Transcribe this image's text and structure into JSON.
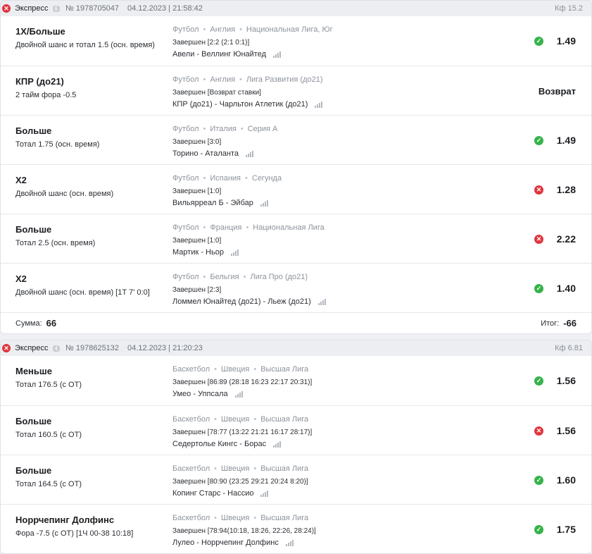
{
  "bets": [
    {
      "type": "Экспресс",
      "count": "6",
      "number": "№ 1978705047",
      "datetime": "04.12.2023 | 21:58:42",
      "kf": "Кф 15.2",
      "sum_label": "Сумма:",
      "sum_value": "66",
      "total_label": "Итог:",
      "total_value": "-66",
      "events": [
        {
          "market": "1X/Больше",
          "outcome": "Двойной шанс и тотал 1.5 (осн. время)",
          "sport": "Футбол",
          "country": "Англия",
          "league": "Национальная Лига, Юг",
          "status": "Завершен [2:2 (2:1 0:1)]",
          "teams": "Авели - Веллинг Юнайтед",
          "result": "win",
          "coef": "1.49"
        },
        {
          "market": "КПР (до21)",
          "outcome": "2 тайм фора -0.5",
          "sport": "Футбол",
          "country": "Англия",
          "league": "Лига Развития (до21)",
          "status": "Завершен [Возврат ставки]",
          "teams": "КПР (до21) - Чарльтон Атлетик (до21)",
          "result": "refund",
          "coef": "Возврат"
        },
        {
          "market": "Больше",
          "outcome": "Тотал 1.75 (осн. время)",
          "sport": "Футбол",
          "country": "Италия",
          "league": "Серия А",
          "status": "Завершен [3:0]",
          "teams": "Торино - Аталанта",
          "result": "win",
          "coef": "1.49"
        },
        {
          "market": "Х2",
          "outcome": "Двойной шанс (осн. время)",
          "sport": "Футбол",
          "country": "Испания",
          "league": "Сегунда",
          "status": "Завершен [1:0]",
          "teams": "Вильярреал Б - Эйбар",
          "result": "loss",
          "coef": "1.28"
        },
        {
          "market": "Больше",
          "outcome": "Тотал 2.5 (осн. время)",
          "sport": "Футбол",
          "country": "Франция",
          "league": "Национальная Лига",
          "status": "Завершен [1:0]",
          "teams": "Мартик - Ньор",
          "result": "loss",
          "coef": "2.22"
        },
        {
          "market": "Х2",
          "outcome": "Двойной шанс (осн. время) [1Т 7' 0:0]",
          "sport": "Футбол",
          "country": "Бельгия",
          "league": "Лига Про (до21)",
          "status": "Завершен [2:3]",
          "teams": "Ломмел Юнайтед (до21) - Льеж (до21)",
          "result": "win",
          "coef": "1.40"
        }
      ]
    },
    {
      "type": "Экспресс",
      "count": "4",
      "number": "№ 1978625132",
      "datetime": "04.12.2023 | 21:20:23",
      "kf": "Кф 6.81",
      "events": [
        {
          "market": "Меньше",
          "outcome": "Тотал 176.5 (с ОТ)",
          "sport": "Баскетбол",
          "country": "Швеция",
          "league": "Высшая Лига",
          "status": "Завершен [86:89 (28:18 16:23 22:17 20:31)]",
          "teams": "Умео - Уппсала",
          "result": "win",
          "coef": "1.56"
        },
        {
          "market": "Больше",
          "outcome": "Тотал 160.5 (с ОТ)",
          "sport": "Баскетбол",
          "country": "Швеция",
          "league": "Высшая Лига",
          "status": "Завершен [78:77 (13:22 21:21 16:17 28:17)]",
          "teams": "Седертолье Кингс - Борас",
          "result": "loss",
          "coef": "1.56"
        },
        {
          "market": "Больше",
          "outcome": "Тотал 164.5 (с ОТ)",
          "sport": "Баскетбол",
          "country": "Швеция",
          "league": "Высшая Лига",
          "status": "Завершен [80:90 (23:25 29:21 20:24 8:20)]",
          "teams": "Копинг Старс - Нассио",
          "result": "win",
          "coef": "1.60"
        },
        {
          "market": "Норрчепинг Долфинс",
          "outcome": "Фора -7.5 (с ОТ) [1Ч 00-38 10:18]",
          "sport": "Баскетбол",
          "country": "Швеция",
          "league": "Высшая Лига",
          "status": "Завершен [78:94(10:18, 18:26, 22:26, 28:24)]",
          "teams": "Лулео - Норрчепинг Долфинс",
          "result": "win",
          "coef": "1.75"
        }
      ]
    }
  ],
  "icons": {
    "lost_bet": "x-circle-icon",
    "win": "check-circle-icon",
    "loss": "x-circle-icon",
    "stats": "bar-chart-icon"
  },
  "colors": {
    "win": "#36b34a",
    "loss": "#e0353f",
    "header_bg": "#eceef1"
  }
}
